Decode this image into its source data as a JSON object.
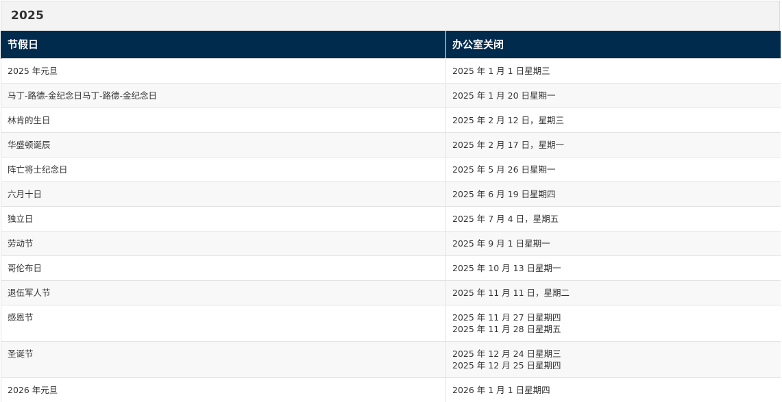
{
  "section": {
    "title": "2025"
  },
  "table": {
    "headers": [
      "节假日",
      "办公室关闭"
    ],
    "rows": [
      {
        "holiday": "2025 年元旦",
        "dates": [
          "2025 年 1 月 1 日星期三"
        ]
      },
      {
        "holiday": "马丁-路德-金纪念日马丁-路德-金纪念日",
        "dates": [
          "2025 年 1 月 20 日星期一"
        ]
      },
      {
        "holiday": "林肯的生日",
        "dates": [
          "2025 年 2 月 12 日，星期三"
        ]
      },
      {
        "holiday": "华盛顿诞辰",
        "dates": [
          "2025 年 2 月 17 日，星期一"
        ]
      },
      {
        "holiday": "阵亡将士纪念日",
        "dates": [
          "2025 年 5 月 26 日星期一"
        ]
      },
      {
        "holiday": "六月十日",
        "dates": [
          "2025 年 6 月 19 日星期四"
        ]
      },
      {
        "holiday": "独立日",
        "dates": [
          "2025 年 7 月 4 日，星期五"
        ]
      },
      {
        "holiday": "劳动节",
        "dates": [
          "2025 年 9 月 1 日星期一"
        ]
      },
      {
        "holiday": "哥伦布日",
        "dates": [
          "2025 年 10 月 13 日星期一"
        ]
      },
      {
        "holiday": "退伍军人节",
        "dates": [
          "2025 年 11 月 11 日，星期二"
        ]
      },
      {
        "holiday": "感恩节",
        "dates": [
          "2025 年 11 月 27 日星期四",
          "2025 年 11 月 28 日星期五"
        ]
      },
      {
        "holiday": "圣诞节",
        "dates": [
          "2025 年 12 月 24 日星期三",
          "2025 年 12 月 25 日星期四"
        ]
      },
      {
        "holiday": "2026 年元旦",
        "dates": [
          "2026 年 1 月 1 日星期四"
        ]
      }
    ]
  }
}
